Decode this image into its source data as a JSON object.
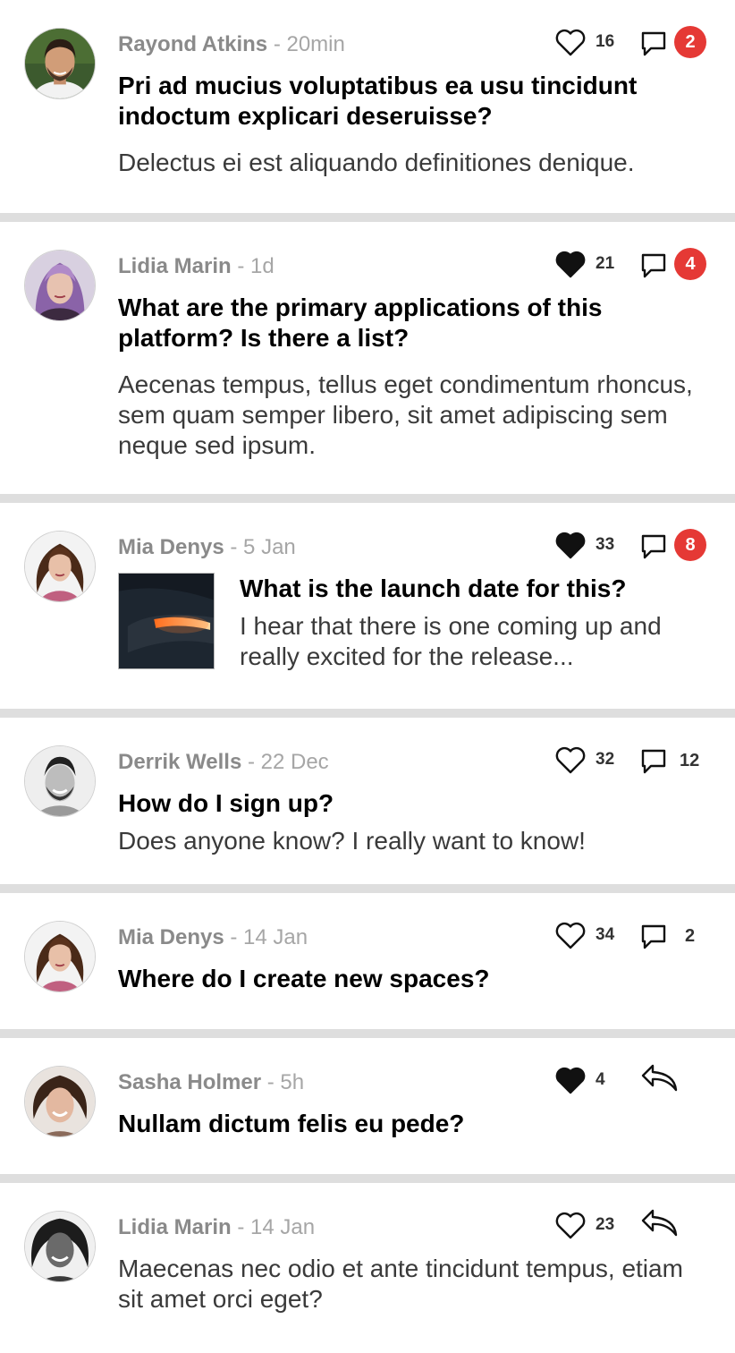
{
  "posts": [
    {
      "author": "Rayond Atkins",
      "time": "- 20min",
      "title": "Pri ad mucius voluptatibus ea usu tincidunt indoctum explicari deseruisse?",
      "body": "Delectus ei est aliquando definitiones denique.",
      "likes": "16",
      "liked": false,
      "comments": "2",
      "comments_badge": true
    },
    {
      "author": "Lidia Marin",
      "time": "- 1d",
      "title": "What are the primary applications of this platform? Is there a list?",
      "body": "Aecenas tempus, tellus eget condimentum rhoncus, sem quam semper libero, sit amet adipiscing sem neque sed ipsum.",
      "likes": "21",
      "liked": true,
      "comments": "4",
      "comments_badge": true
    },
    {
      "author": "Mia Denys",
      "time": "- 5 Jan",
      "title": "What is the launch date for this?",
      "body": "I hear that there is one coming up and really excited for the release...",
      "likes": "33",
      "liked": true,
      "comments": "8",
      "comments_badge": true,
      "has_thumbnail": true
    },
    {
      "author": "Derrik Wells",
      "time": "- 22 Dec",
      "title": "How do I sign up?",
      "body": "Does anyone know? I really want to know!",
      "likes": "32",
      "liked": false,
      "comments": "12",
      "comments_badge": false
    },
    {
      "author": "Mia Denys",
      "time": "- 14 Jan",
      "title": "Where do I create new spaces?",
      "likes": "34",
      "liked": false,
      "comments": "2",
      "comments_badge": false
    },
    {
      "author": "Sasha Holmer",
      "time": "- 5h",
      "title": "Nullam dictum felis eu pede?",
      "likes": "4",
      "liked": true,
      "action": "reply-icon"
    },
    {
      "author": "Lidia Marin",
      "time": "- 14 Jan",
      "body": "Maecenas nec odio et ante tincidunt tempus, etiam sit amet orci eget?",
      "likes": "23",
      "liked": false,
      "action": "reply-icon"
    }
  ],
  "colors": {
    "badge": "#e53935",
    "divider": "#dedede",
    "author": "#8a8a8a",
    "timestamp": "#a6a6a6",
    "body_text": "#3a3a3a"
  }
}
